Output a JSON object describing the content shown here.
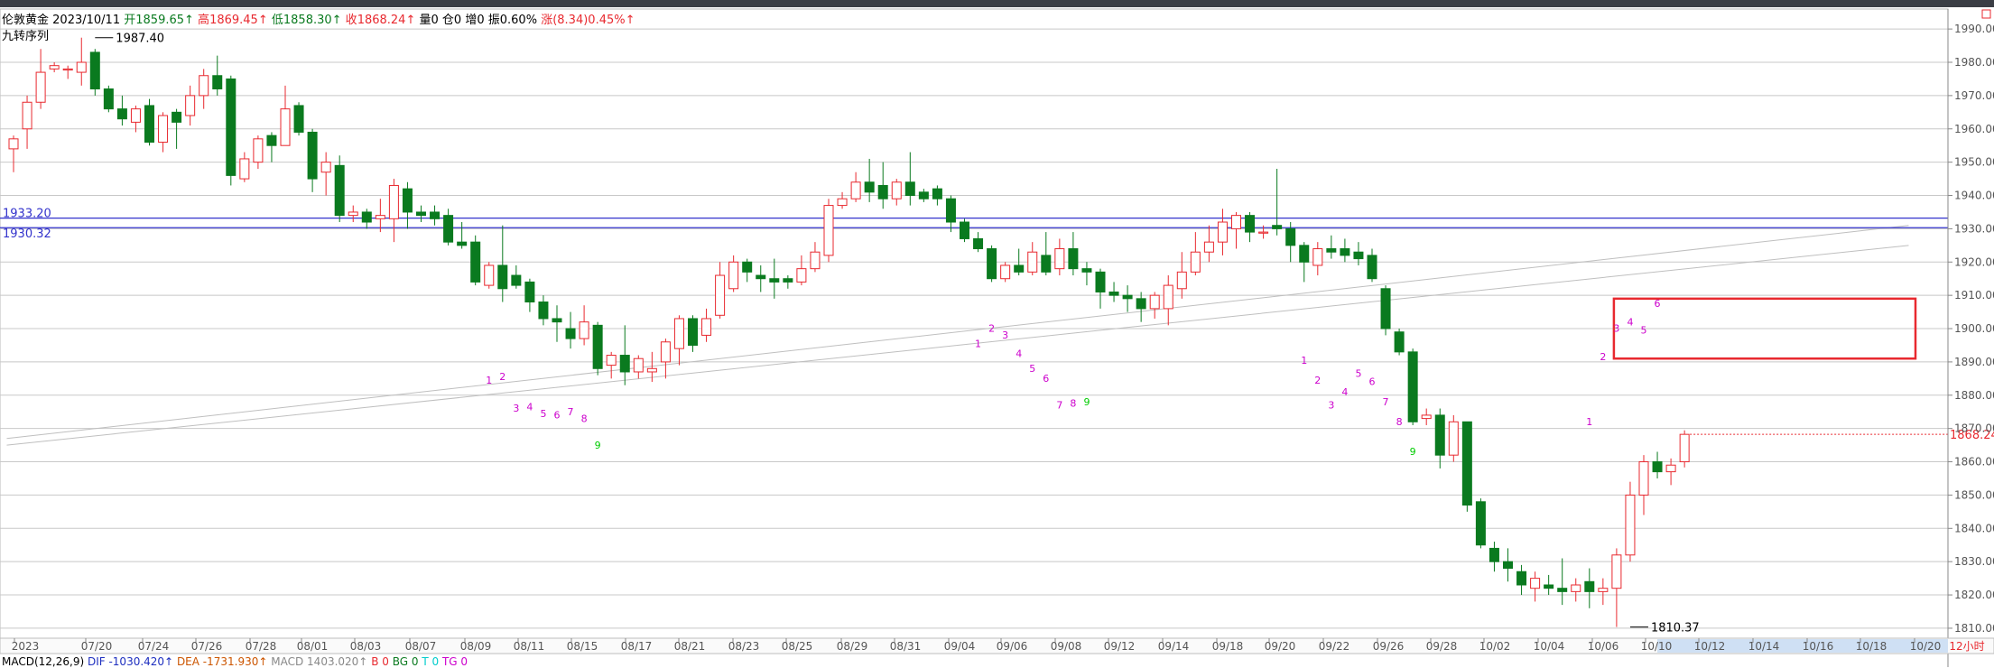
{
  "header": {
    "instrument": "伦敦黄金",
    "date": "2023/10/11",
    "open_label": "开",
    "open": "1859.65↑",
    "high_label": "高",
    "high": "1869.45↑",
    "low_label": "低",
    "low": "1858.30↑",
    "close_label": "收",
    "close": "1868.24↑",
    "volume": "量0",
    "position": "仓0",
    "increase": "增0",
    "amplitude": "振0.60%",
    "change": "涨(8.34)0.45%↑"
  },
  "indicator_name": "九转序列",
  "macd": {
    "name": "MACD(12,26,9)",
    "dif": "DIF -1030.420↑",
    "dea": "DEA -1731.930↑",
    "macd": "MACD 1403.020↑",
    "b": "B 0",
    "bg": "BG 0",
    "t": "T 0",
    "tg": "TG 0"
  },
  "colors": {
    "up": "#e8292f",
    "down": "#0a7a1f",
    "level_line": "#3333cc",
    "td_label": "#cc00cc",
    "td_nine": "#00cc00",
    "box": "#e8292f"
  },
  "chart_data": {
    "type": "candlestick",
    "ylim": [
      1807,
      1996
    ],
    "y_ticks": [
      1810,
      1820,
      1830,
      1840,
      1850,
      1860,
      1870,
      1880,
      1890,
      1900,
      1910,
      1920,
      1930,
      1940,
      1950,
      1960,
      1970,
      1980,
      1990
    ],
    "x_labels": [
      "2023",
      "07/20",
      "07/24",
      "07/26",
      "07/28",
      "08/01",
      "08/03",
      "08/07",
      "08/09",
      "08/11",
      "08/15",
      "08/17",
      "08/21",
      "08/23",
      "08/25",
      "08/29",
      "08/31",
      "09/04",
      "09/06",
      "09/08",
      "09/12",
      "09/14",
      "09/18",
      "09/20",
      "09/22",
      "09/26",
      "09/28",
      "10/02",
      "10/04",
      "10/06",
      "10/10",
      "10/12",
      "10/14",
      "10/16",
      "10/18",
      "10/20"
    ],
    "period": "12小时",
    "last_price": "1868.24",
    "levels": [
      {
        "label": "1933.20",
        "value": 1933.2
      },
      {
        "label": "1930.32",
        "value": 1930.32
      }
    ],
    "annotations": [
      {
        "label": "1987.40",
        "value": 1987.4,
        "index": 6
      },
      {
        "label": "1810.37",
        "value": 1810.37,
        "index": 119
      }
    ],
    "candles": [
      [
        1954,
        1957,
        1947,
        1958
      ],
      [
        1960,
        1968,
        1954,
        1970
      ],
      [
        1968,
        1977,
        1966,
        1984
      ],
      [
        1978,
        1979,
        1977,
        1980
      ],
      [
        1978,
        1978,
        1975,
        1979
      ],
      [
        1977,
        1980,
        1973,
        1987.4
      ],
      [
        1983,
        1972,
        1970,
        1984
      ],
      [
        1972,
        1966,
        1965,
        1973
      ],
      [
        1966,
        1963,
        1961,
        1970
      ],
      [
        1962,
        1966,
        1959,
        1967
      ],
      [
        1967,
        1956,
        1955,
        1969
      ],
      [
        1956,
        1964,
        1953,
        1965
      ],
      [
        1965,
        1962,
        1954,
        1966
      ],
      [
        1964,
        1970,
        1961,
        1973
      ],
      [
        1970,
        1976,
        1966,
        1978
      ],
      [
        1976,
        1972,
        1970,
        1982
      ],
      [
        1975,
        1946,
        1943,
        1976
      ],
      [
        1945,
        1951,
        1944,
        1953
      ],
      [
        1950,
        1957,
        1948,
        1958
      ],
      [
        1958,
        1955,
        1950,
        1959
      ],
      [
        1955,
        1966,
        1955,
        1973
      ],
      [
        1967,
        1959,
        1958,
        1968
      ],
      [
        1959,
        1945,
        1941,
        1960
      ],
      [
        1947,
        1950,
        1940,
        1953
      ],
      [
        1949,
        1934,
        1932,
        1952
      ],
      [
        1934,
        1935,
        1932,
        1937
      ],
      [
        1935,
        1932,
        1930,
        1936
      ],
      [
        1933,
        1934,
        1929,
        1939
      ],
      [
        1933,
        1943,
        1926,
        1945
      ],
      [
        1942,
        1935,
        1930,
        1944
      ],
      [
        1935,
        1934,
        1932,
        1937
      ],
      [
        1935,
        1933,
        1931,
        1937
      ],
      [
        1934,
        1926,
        1925,
        1936
      ],
      [
        1926,
        1925,
        1924,
        1932
      ],
      [
        1926,
        1914,
        1913,
        1928
      ],
      [
        1913,
        1919,
        1912,
        1920
      ],
      [
        1919,
        1912,
        1908,
        1931
      ],
      [
        1916,
        1913,
        1912,
        1919
      ],
      [
        1914,
        1908,
        1905,
        1915
      ],
      [
        1908,
        1903,
        1901,
        1910
      ],
      [
        1903,
        1902,
        1896,
        1907
      ],
      [
        1900,
        1897,
        1894,
        1905
      ],
      [
        1897,
        1902,
        1895,
        1907
      ],
      [
        1901,
        1888,
        1886,
        1902
      ],
      [
        1889,
        1892,
        1885,
        1893
      ],
      [
        1892,
        1887,
        1883,
        1901
      ],
      [
        1887,
        1891,
        1885,
        1892
      ],
      [
        1887,
        1888,
        1884,
        1893
      ],
      [
        1890,
        1896,
        1885,
        1897
      ],
      [
        1894,
        1903,
        1889,
        1904
      ],
      [
        1903,
        1895,
        1893,
        1904
      ],
      [
        1898,
        1903,
        1896,
        1906
      ],
      [
        1904,
        1916,
        1903,
        1920
      ],
      [
        1912,
        1920,
        1911,
        1922
      ],
      [
        1920,
        1917,
        1914,
        1921
      ],
      [
        1916,
        1915,
        1911,
        1919
      ],
      [
        1915,
        1914,
        1909,
        1921
      ],
      [
        1915,
        1914,
        1912,
        1916
      ],
      [
        1914,
        1918,
        1913,
        1922
      ],
      [
        1918,
        1923,
        1917,
        1926
      ],
      [
        1922,
        1937,
        1920,
        1939
      ],
      [
        1937,
        1939,
        1936,
        1941
      ],
      [
        1939,
        1944,
        1938,
        1947
      ],
      [
        1944,
        1941,
        1938,
        1951
      ],
      [
        1943,
        1939,
        1936,
        1950
      ],
      [
        1939,
        1944,
        1937,
        1945
      ],
      [
        1944,
        1940,
        1937,
        1953
      ],
      [
        1941,
        1939,
        1938,
        1942
      ],
      [
        1942,
        1939,
        1937,
        1943
      ],
      [
        1939,
        1932,
        1929,
        1940
      ],
      [
        1932,
        1927,
        1926,
        1933
      ],
      [
        1927,
        1924,
        1923,
        1929
      ],
      [
        1924,
        1915,
        1914,
        1925
      ],
      [
        1915,
        1919,
        1914,
        1920
      ],
      [
        1919,
        1917,
        1916,
        1924
      ],
      [
        1917,
        1923,
        1916,
        1926
      ],
      [
        1922,
        1917,
        1916,
        1929
      ],
      [
        1918,
        1924,
        1916,
        1927
      ],
      [
        1924,
        1918,
        1916,
        1929
      ],
      [
        1918,
        1917,
        1913,
        1920
      ],
      [
        1917,
        1911,
        1906,
        1918
      ],
      [
        1911,
        1910,
        1908,
        1914
      ],
      [
        1910,
        1909,
        1905,
        1913
      ],
      [
        1909,
        1906,
        1902,
        1911
      ],
      [
        1906,
        1910,
        1903,
        1911
      ],
      [
        1906,
        1913,
        1901,
        1916
      ],
      [
        1912,
        1917,
        1909,
        1923
      ],
      [
        1917,
        1923,
        1916,
        1929
      ],
      [
        1923,
        1926,
        1920,
        1931
      ],
      [
        1926,
        1932,
        1922,
        1936
      ],
      [
        1930,
        1934,
        1924,
        1935
      ],
      [
        1934,
        1929,
        1926,
        1935
      ],
      [
        1929,
        1929,
        1927,
        1931
      ],
      [
        1931,
        1930,
        1928,
        1948
      ],
      [
        1930,
        1925,
        1920,
        1932
      ],
      [
        1925,
        1920,
        1914,
        1926
      ],
      [
        1919,
        1924,
        1916,
        1926
      ],
      [
        1924,
        1923,
        1921,
        1928
      ],
      [
        1924,
        1922,
        1920,
        1927
      ],
      [
        1923,
        1921,
        1919,
        1926
      ],
      [
        1922,
        1915,
        1914,
        1924
      ],
      [
        1912,
        1900,
        1898,
        1913
      ],
      [
        1899,
        1893,
        1892,
        1900
      ],
      [
        1893,
        1872,
        1871,
        1894
      ],
      [
        1873,
        1874,
        1871,
        1876
      ],
      [
        1874,
        1862,
        1858,
        1876
      ],
      [
        1862,
        1872,
        1860,
        1874
      ],
      [
        1872,
        1847,
        1845,
        1872
      ],
      [
        1848,
        1835,
        1834,
        1849
      ],
      [
        1834,
        1830,
        1827,
        1836
      ],
      [
        1830,
        1828,
        1824,
        1834
      ],
      [
        1827,
        1823,
        1820,
        1829
      ],
      [
        1822,
        1825,
        1818,
        1827
      ],
      [
        1823,
        1822,
        1820,
        1826
      ],
      [
        1822,
        1821,
        1817,
        1831
      ],
      [
        1821,
        1823,
        1818,
        1825
      ],
      [
        1824,
        1821,
        1816,
        1828
      ],
      [
        1821,
        1822,
        1817,
        1825
      ],
      [
        1822,
        1832,
        1810.37,
        1834
      ],
      [
        1832,
        1850,
        1830,
        1854
      ],
      [
        1850,
        1860,
        1844,
        1862
      ],
      [
        1860,
        1857,
        1855,
        1863
      ],
      [
        1857,
        1859,
        1853,
        1861
      ],
      [
        1860,
        1868.24,
        1858.3,
        1869.45
      ]
    ],
    "td_counts": [
      {
        "index": 35,
        "value": 1883.5,
        "label": "1"
      },
      {
        "index": 36,
        "value": 1884.5,
        "label": "2"
      },
      {
        "index": 37,
        "value": 1875,
        "label": "3"
      },
      {
        "index": 38,
        "value": 1875.5,
        "label": "4"
      },
      {
        "index": 39,
        "value": 1873.5,
        "label": "5"
      },
      {
        "index": 40,
        "value": 1873,
        "label": "6"
      },
      {
        "index": 41,
        "value": 1874,
        "label": "7"
      },
      {
        "index": 42,
        "value": 1872,
        "label": "8"
      },
      {
        "index": 43,
        "value": 1864,
        "label": "9"
      },
      {
        "index": 71,
        "value": 1894.5,
        "label": "1"
      },
      {
        "index": 72,
        "value": 1899,
        "label": "2"
      },
      {
        "index": 73,
        "value": 1897,
        "label": "3"
      },
      {
        "index": 74,
        "value": 1891.5,
        "label": "4"
      },
      {
        "index": 75,
        "value": 1887,
        "label": "5"
      },
      {
        "index": 76,
        "value": 1884,
        "label": "6"
      },
      {
        "index": 77,
        "value": 1876,
        "label": "7"
      },
      {
        "index": 78,
        "value": 1876.5,
        "label": "8"
      },
      {
        "index": 79,
        "value": 1877,
        "label": "9"
      },
      {
        "index": 95,
        "value": 1889.5,
        "label": "1"
      },
      {
        "index": 96,
        "value": 1883.5,
        "label": "2"
      },
      {
        "index": 97,
        "value": 1876,
        "label": "3"
      },
      {
        "index": 98,
        "value": 1880,
        "label": "4"
      },
      {
        "index": 99,
        "value": 1885.5,
        "label": "5"
      },
      {
        "index": 100,
        "value": 1883,
        "label": "6"
      },
      {
        "index": 101,
        "value": 1877,
        "label": "7"
      },
      {
        "index": 102,
        "value": 1871,
        "label": "8"
      },
      {
        "index": 103,
        "value": 1862,
        "label": "9"
      },
      {
        "index": 116,
        "value": 1871,
        "label": "1"
      },
      {
        "index": 117,
        "value": 1890.5,
        "label": "2"
      },
      {
        "index": 118,
        "value": 1899,
        "label": "3"
      },
      {
        "index": 119,
        "value": 1901,
        "label": "4"
      },
      {
        "index": 120,
        "value": 1898.5,
        "label": "5"
      },
      {
        "index": 121,
        "value": 1906.5,
        "label": "6"
      }
    ],
    "trendlines": [
      {
        "from": [
          -0.5,
          1865
        ],
        "to": [
          139.5,
          1925
        ]
      },
      {
        "from": [
          -0.5,
          1867
        ],
        "to": [
          139.5,
          1931
        ]
      }
    ],
    "highlight_box": {
      "from_index": 118,
      "to_index": 140,
      "from_value": 1891,
      "to_value": 1909
    }
  }
}
